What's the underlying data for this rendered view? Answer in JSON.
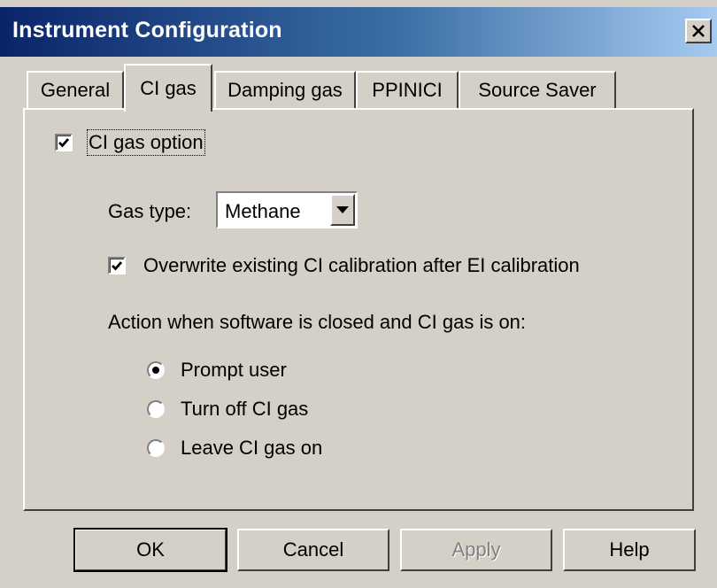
{
  "window": {
    "title": "Instrument Configuration",
    "close_label": "✕"
  },
  "tabs": [
    {
      "label": "General",
      "active": false
    },
    {
      "label": "CI gas",
      "active": true
    },
    {
      "label": "Damping gas",
      "active": false
    },
    {
      "label": "PPINICI",
      "active": false
    },
    {
      "label": "Source Saver",
      "active": false
    }
  ],
  "ci_gas": {
    "option_label": "CI gas option",
    "option_checked": true,
    "gas_type_label": "Gas type:",
    "gas_type_value": "Methane",
    "overwrite_label": "Overwrite existing CI calibration after EI calibration",
    "overwrite_checked": true,
    "action_heading": "Action when software is closed and CI gas is on:",
    "actions": [
      {
        "label": "Prompt user",
        "selected": true
      },
      {
        "label": "Turn off CI gas",
        "selected": false
      },
      {
        "label": "Leave CI gas on",
        "selected": false
      }
    ]
  },
  "buttons": {
    "ok": "OK",
    "cancel": "Cancel",
    "apply": "Apply",
    "help": "Help"
  },
  "icons": {
    "check": "check-icon",
    "dropdown": "chevron-down-icon",
    "close": "close-icon"
  }
}
